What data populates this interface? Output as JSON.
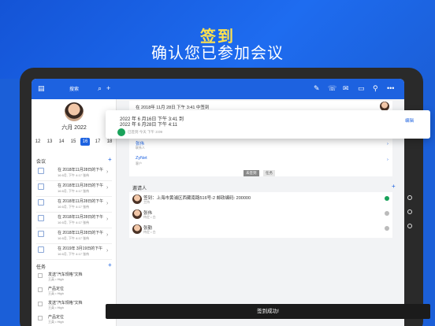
{
  "hero": {
    "title": "签到",
    "subtitle": "确认您已参加会议"
  },
  "topbar": {
    "search_label": "搜索"
  },
  "sidebar": {
    "user_date": "六月 2022",
    "week_days": [
      "12",
      "13",
      "14",
      "15",
      "16",
      "17",
      "18"
    ],
    "selected_day": "16",
    "meetings_header": "会议",
    "meetings": [
      {
        "title": "在 2018年11月28日的下午",
        "sub": "16 6月, 下午 4:17  张伟"
      },
      {
        "title": "在 2018年11月28日的下午",
        "sub": "16 6月, 下午 4:17  张伟"
      },
      {
        "title": "在 2018年11月28日的下午",
        "sub": "16 6月, 下午 4:17  张伟"
      },
      {
        "title": "在 2018年11月28日的下午",
        "sub": "16 6月, 下午 4:17  张伟"
      },
      {
        "title": "在 2018年11月28日的下午",
        "sub": "16 6月, 下午 4:17  张伟"
      },
      {
        "title": "在 2019年 3月19日的下午",
        "sub": "16 6月, 下午 4:17  张伟"
      }
    ],
    "tasks_header": "任务",
    "tasks": [
      {
        "title": "发送\"汽车规格\"文档",
        "sub": "王英 • High"
      },
      {
        "title": "产品定位",
        "sub": "王英 • High"
      },
      {
        "title": "发送\"汽车规格\"文档",
        "sub": "王英 • High"
      },
      {
        "title": "产品定位",
        "sub": "王英 • High"
      }
    ]
  },
  "main": {
    "meeting_title": "在 2018年 11月 28日 下午 3:41 中签到",
    "contacts": [
      {
        "name": "张伟",
        "role": "联系人"
      },
      {
        "name": "ZyNet",
        "role": "客户"
      }
    ],
    "toggle": [
      "未签到",
      "任务"
    ],
    "invitees_header": "邀请人",
    "invitees": [
      {
        "name": "签到：上海市黄浦区西藏南路516号-2 邮政编码: 200000",
        "role": "主持"
      },
      {
        "name": "张伟",
        "role": "待定 • 白"
      },
      {
        "name": "张勤",
        "role": "待定 • 白"
      }
    ]
  },
  "popup": {
    "line1": "2022 年 6 月16日 下午 3:41 到",
    "line2": "2022 年 6 月28日 下午 4:11",
    "checkin_label": "已签到 今天 下午 3:09",
    "edit_label": "编辑"
  },
  "toast": {
    "text": "签到成功!"
  },
  "colors": {
    "brand": "#1d62e0",
    "success": "#19a25a",
    "hero_accent": "#ffe14d"
  }
}
